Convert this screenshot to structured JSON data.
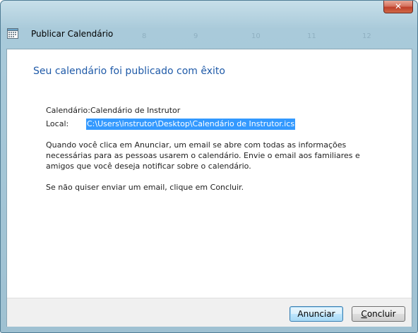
{
  "window": {
    "title": "Publicar Calendário",
    "close_glyph": "✕",
    "background_numbers": [
      "8",
      "9",
      "10",
      "11",
      "12"
    ]
  },
  "content": {
    "heading": "Seu calendário foi publicado com êxito",
    "calendar_label": "Calendário:",
    "calendar_value": "Calendário de Instrutor",
    "location_label": "Local:",
    "location_value": "C:\\Users\\instrutor\\Desktop\\Calendário de Instrutor.ics",
    "paragraph1": "Quando você clica em Anunciar, um email se abre com todas as informações necessárias para as pessoas usarem o calendário. Envie o email aos familiares e amigos que você deseja notificar sobre o calendário.",
    "paragraph2": "Se não quiser enviar um email, clique em Concluir."
  },
  "buttons": {
    "announce": "Anunciar",
    "finish_first_letter": "C",
    "finish_rest": "oncluir"
  },
  "colors": {
    "heading": "#1f5aa8",
    "selection": "#3399ff",
    "default_button_border": "#3c7fb1"
  },
  "icons": {
    "window_icon": "calendar-icon",
    "close": "close-icon"
  }
}
